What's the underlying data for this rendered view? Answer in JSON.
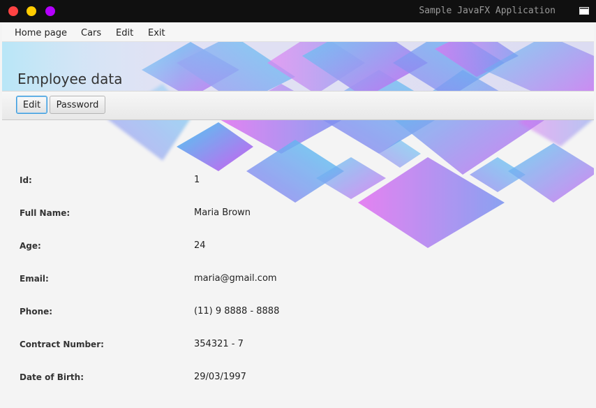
{
  "window": {
    "title": "Sample JavaFX Application"
  },
  "menu": [
    "Home page",
    "Cars",
    "Edit",
    "Exit"
  ],
  "header": {
    "title": "Employee data"
  },
  "toolbar": {
    "edit_label": "Edit",
    "password_label": "Password"
  },
  "fields": [
    {
      "label": "Id:",
      "value": "1"
    },
    {
      "label": "Full Name:",
      "value": "Maria Brown"
    },
    {
      "label": "Age:",
      "value": "24"
    },
    {
      "label": "Email:",
      "value": "maria@gmail.com"
    },
    {
      "label": "Phone:",
      "value": "(11) 9 8888 - 8888"
    },
    {
      "label": "Contract Number:",
      "value": "354321 - 7"
    },
    {
      "label": "Date of Birth:",
      "value": "29/03/1997"
    }
  ],
  "colors": {
    "accent_blue": "#3ec7f0",
    "accent_purple": "#c850f0",
    "focus": "#3a9bdc"
  }
}
